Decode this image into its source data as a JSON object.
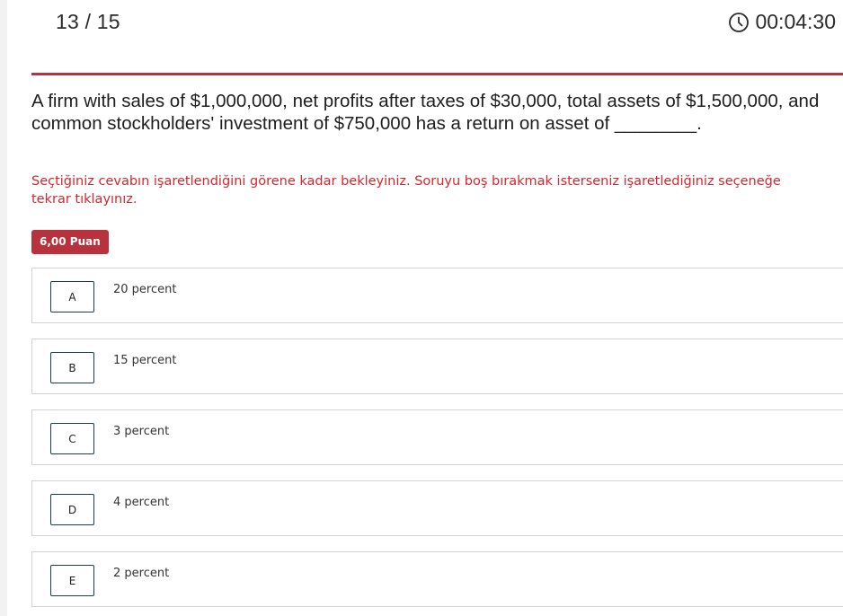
{
  "header": {
    "counter": "13 / 15",
    "timer": "00:04:30",
    "timer_icon": "clock-icon"
  },
  "question": {
    "text": "A firm with sales of $1,000,000, net profits after taxes of $30,000, total assets of $1,500,000, and common stockholders' investment of $750,000 has a return on asset of ________."
  },
  "notice": "Seçtiğiniz cevabın işaretlendiğini görene kadar bekleyiniz. Soruyu boş bırakmak isterseniz işaretlediğiniz seçeneğe tekrar tıklayınız.",
  "points_badge": "6,00 Puan",
  "colors": {
    "accent": "#b8323d",
    "notice": "#d6262f",
    "letter_border": "#1f3a54"
  },
  "options": [
    {
      "letter": "A",
      "text": "20 percent"
    },
    {
      "letter": "B",
      "text": "15 percent"
    },
    {
      "letter": "C",
      "text": "3 percent"
    },
    {
      "letter": "D",
      "text": "4 percent"
    },
    {
      "letter": "E",
      "text": "2 percent"
    }
  ]
}
